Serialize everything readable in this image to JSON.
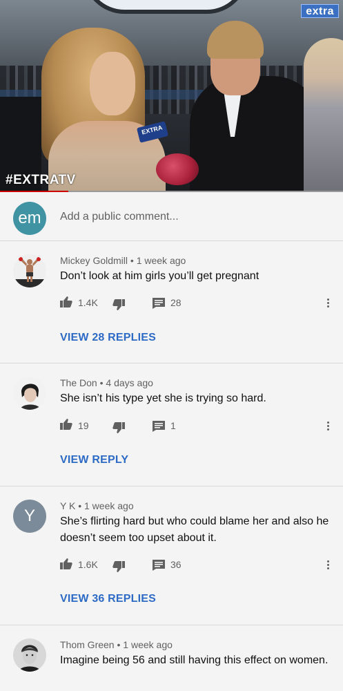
{
  "video": {
    "logo": "extra",
    "hashtag": "#EXTRATV",
    "mic_label": "EXTRA",
    "progress": 0.2
  },
  "add_comment": {
    "avatar_initials": "em",
    "avatar_color": "#3f93a3",
    "placeholder": "Add a public comment..."
  },
  "comments": [
    {
      "author": "Mickey Goldmill",
      "time": "1 week ago",
      "text": "Don’t look at him girls you’ll get pregnant",
      "likes": "1.4K",
      "reply_count": "28",
      "replies_label": "VIEW 28 REPLIES",
      "avatar_icon": "boxer-photo-avatar"
    },
    {
      "author": "The Don",
      "time": "4 days ago",
      "text": "She isn’t his type yet she is trying so hard.",
      "likes": "19",
      "reply_count": "1",
      "replies_label": "VIEW REPLY",
      "avatar_icon": "portrait-photo-avatar"
    },
    {
      "author": "Y K",
      "time": "1 week ago",
      "text": "She’s flirting hard but who could blame her and also he doesn’t seem too upset about it.",
      "likes": "1.6K",
      "reply_count": "36",
      "replies_label": "VIEW 36 REPLIES",
      "avatar_initials": "Y",
      "avatar_color": "#7b8b99"
    },
    {
      "author": "Thom Green",
      "time": "1 week ago",
      "text": "Imagine being 56 and still having this effect on women.",
      "avatar_icon": "boy-photo-avatar"
    }
  ],
  "separator": "•",
  "colors": {
    "link": "#2d6ac5",
    "muted": "#606060",
    "background": "#f4f4f4"
  }
}
